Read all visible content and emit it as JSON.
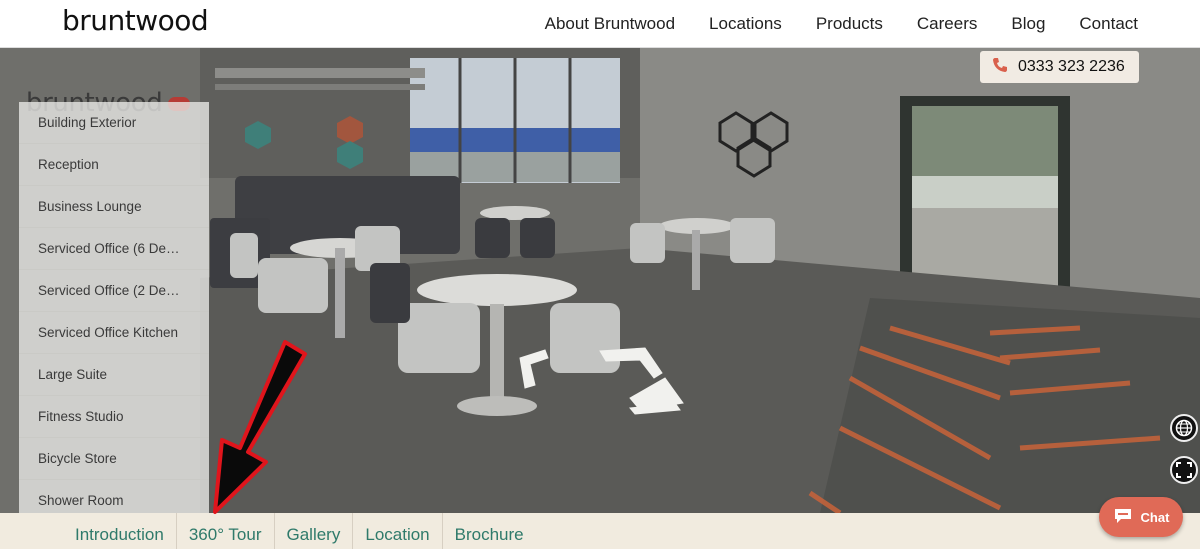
{
  "header": {
    "logo": "bruntwood",
    "nav": [
      "About Bruntwood",
      "Locations",
      "Products",
      "Careers",
      "Blog",
      "Contact"
    ]
  },
  "tour": {
    "brand": "bruntwood",
    "phone": "0333 323 2236",
    "scenes": [
      "Building Exterior",
      "Reception",
      "Business Lounge",
      "Serviced Office (6 De…",
      "Serviced Office (2 De…",
      "Serviced Office Kitchen",
      "Large Suite",
      "Fitness Studio",
      "Bicycle Store",
      "Shower Room"
    ],
    "icons": [
      "globe-icon",
      "fullscreen-icon",
      "phone-icon",
      "chat-icon"
    ]
  },
  "tabs": [
    "Introduction",
    "360° Tour",
    "Gallery",
    "Location",
    "Brochure"
  ],
  "chat": {
    "label": "Chat"
  },
  "colors": {
    "tab_text": "#2f7a6a",
    "chat": "#e06a57",
    "arrow_outline": "#e0151c",
    "tab_bar": "#f1ebdf"
  }
}
